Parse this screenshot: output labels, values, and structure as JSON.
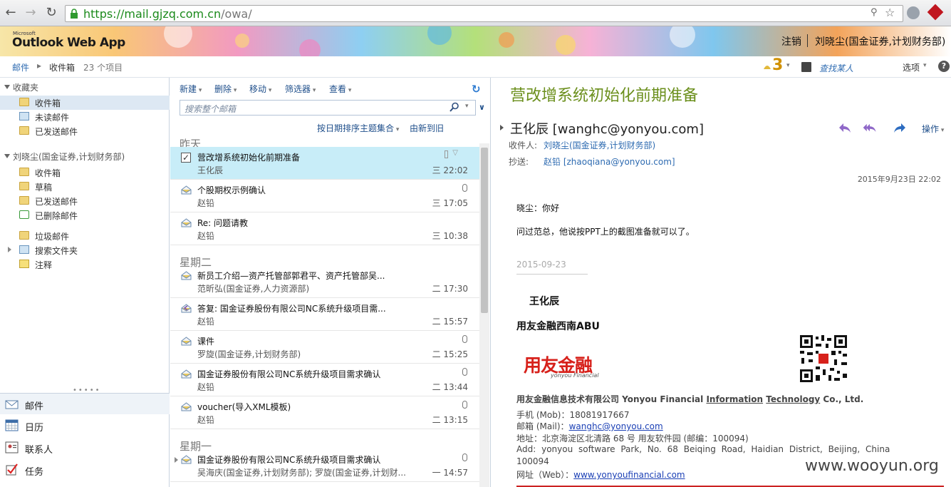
{
  "browser": {
    "url_host": "https://mail.gjzq.com.cn",
    "url_path": "/owa/"
  },
  "banner": {
    "logo_small": "Microsoft",
    "logo": "Outlook Web App",
    "signout": "注销",
    "username": "刘晓尘(国金证券,计划财务部)"
  },
  "crumb": {
    "mail": "邮件",
    "inbox": "收件箱",
    "count": "23 个项目",
    "reminders": "3",
    "find_people": "查找某人",
    "options": "选项",
    "help": "?"
  },
  "leftnav": {
    "favorites_head": "收藏夹",
    "favorites": [
      {
        "label": "收件箱"
      },
      {
        "label": "未读邮件"
      },
      {
        "label": "已发送邮件"
      }
    ],
    "mailbox_head": "刘晓尘(国金证券,计划财务部)",
    "mailbox": [
      {
        "label": "收件箱"
      },
      {
        "label": "草稿"
      },
      {
        "label": "已发送邮件"
      },
      {
        "label": "已删除邮件"
      },
      {
        "label": "垃圾邮件"
      },
      {
        "label": "搜索文件夹"
      },
      {
        "label": "注释"
      }
    ],
    "modules": [
      {
        "label": "邮件"
      },
      {
        "label": "日历"
      },
      {
        "label": "联系人"
      },
      {
        "label": "任务"
      }
    ]
  },
  "toolbar": {
    "new": "新建",
    "delete": "删除",
    "move": "移动",
    "filter": "筛选器",
    "view": "查看",
    "search_placeholder": "搜索整个邮箱",
    "sort_by": "按日期排序主题集合",
    "sort_order": "由新到旧"
  },
  "groups": {
    "yesterday": "昨天",
    "tuesday": "星期二",
    "monday": "星期一"
  },
  "messages": [
    {
      "subject": "营改增系统初始化前期准备",
      "from": "王化辰",
      "time": "三 22:02"
    },
    {
      "subject": "个股期权示例确认",
      "from": "赵铅",
      "time": "三 17:05"
    },
    {
      "subject": "Re: 问题请教",
      "from": "赵铅",
      "time": "三 10:38"
    },
    {
      "subject": "新员工介绍—资产托管部郭君平、资产托管部吴...",
      "from": "范昕弘(国金证券,人力资源部)",
      "time": "二 17:30"
    },
    {
      "subject": "答复: 国金证券股份有限公司NC系统升级项目需...",
      "from": "赵铅",
      "time": "二 15:57"
    },
    {
      "subject": "课件",
      "from": "罗旋(国金证券,计划财务部)",
      "time": "二 15:25"
    },
    {
      "subject": "国金证券股份有限公司NC系统升级项目需求确认",
      "from": "赵铅",
      "time": "二 13:44"
    },
    {
      "subject": "voucher(导入XML模板)",
      "from": "赵铅",
      "time": "二 13:15"
    },
    {
      "subject": "国金证券股份有限公司NC系统升级项目需求确认",
      "from": "吴海庆(国金证券,计划财务部); 罗旋(国金证券,计划财...",
      "time": "一 14:57"
    }
  ],
  "reader": {
    "subject": "营改增系统初始化前期准备",
    "sender": "王化辰 [wanghc@yonyou.com]",
    "to_label": "收件人:",
    "to": "刘晓尘(国金证券,计划财务部)",
    "cc_label": "抄送:",
    "cc": "赵铅 [zhaoqiana@yonyou.com]",
    "actions": "操作",
    "date": "2015年9月23日 22:02",
    "greeting": "晓尘：你好",
    "body": "问过范总，他说按PPT上的截图准备就可以了。",
    "date2": "2015-09-23",
    "sig_name": "王化辰",
    "sig_dept": "用友金融西南ABU",
    "logo_cn": "用友金融",
    "logo_en": "yonyou Financial",
    "company_a": "用友金融信息技术有限公司 Yonyou Financial ",
    "company_b": "Information",
    "company_c": " ",
    "company_d": "Technology",
    "company_e": " Co., Ltd.",
    "mobile": "手机 (Mob)：18081917667",
    "mail_label": "邮箱 (Mail)：",
    "mail": "wanghc@yonyou.com",
    "address": "地址：北京海淀区北清路 68 号 用友软件园 (邮编：100094)",
    "address_en1": "Add: yonyou software Park, No. 68 Beiqing Road, Haidian District, Beijing, China",
    "address_en2": "100094",
    "web_label": "网址（Web）：",
    "web": "www.yonyoufinancial.com"
  },
  "watermark": "www.wooyun.org"
}
